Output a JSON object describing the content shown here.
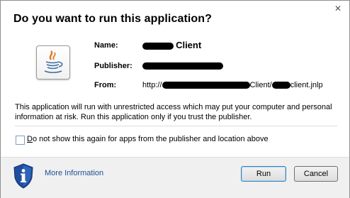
{
  "dialog": {
    "title": "Do you want to run this application?",
    "close_glyph": "✕"
  },
  "info": {
    "name_label": "Name:",
    "name_value": "Client",
    "publisher_label": "Publisher:",
    "from_label": "From:",
    "from_prefix": "http://",
    "from_middle": "Client/",
    "from_suffix": "client.jnlp"
  },
  "warning": {
    "text": "This application will run with unrestricted access which may put your computer and personal information at risk. Run this application only if you trust the publisher."
  },
  "checkbox": {
    "label_first": "D",
    "label_rest": "o not show this again for apps from the publisher and location above",
    "checked": false
  },
  "footer": {
    "more_info": "More Information",
    "run": "Run",
    "cancel": "Cancel"
  },
  "icons": {
    "app": "java-icon",
    "shield": "info-shield-icon",
    "close": "close-icon"
  },
  "colors": {
    "link": "#1c4f96",
    "shield": "#1f4ea0"
  }
}
